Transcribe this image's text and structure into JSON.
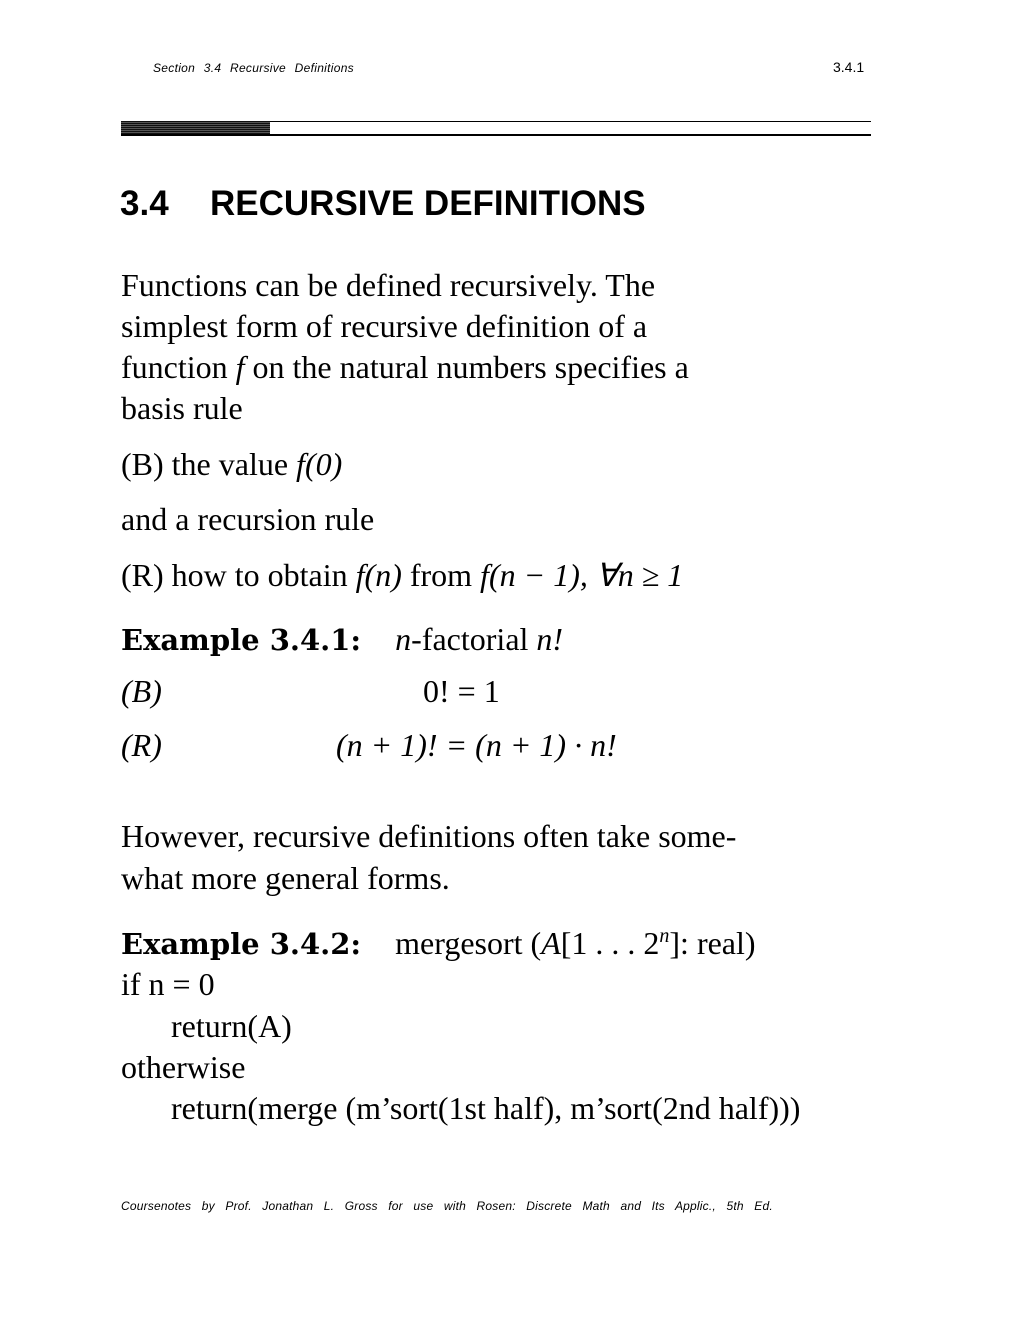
{
  "header": {
    "running_title": "Section 3.4 Recursive Definitions",
    "page_number": "3.4.1"
  },
  "section": {
    "number": "3.4",
    "title": "RECURSIVE DEFINITIONS"
  },
  "intro": {
    "lines": [
      "Functions can be defined recursively.  The",
      "simplest form of recursive definition of a",
      "function",
      "on the natural numbers specifies a",
      "basis rule"
    ],
    "var_f": "f"
  },
  "basis": {
    "label": "(B) the value",
    "expr": "f(0)"
  },
  "recursion_intro": "and a recursion rule",
  "recursion": {
    "label": "(R) how to obtain",
    "expr1": "f(n)",
    "from": "from",
    "expr2": "f(n − 1), ∀n ≥ 1"
  },
  "example1": {
    "label": "Example 3.4.1:",
    "var": "n",
    "desc": "-factorial",
    "nfact": "n!",
    "rows": [
      {
        "tag": "(B)",
        "formula": "0! = 1"
      },
      {
        "tag": "(R)",
        "formula": "(n + 1)! = (n + 1) · n!"
      }
    ]
  },
  "general": {
    "lines": [
      "However, recursive definitions often take some-",
      "what more general forms."
    ]
  },
  "example2": {
    "label": "Example 3.4.2:",
    "signature_pre": "mergesort (",
    "signature_A": "A",
    "signature_range": "[1 . . . 2",
    "signature_exp": "n",
    "signature_post": "]:  real)",
    "code": [
      "if n = 0",
      "return(A)",
      "otherwise",
      "return(merge (m’sort(1st half), m’sort(2nd half)))"
    ]
  },
  "footer": {
    "text": "Coursenotes by Prof.  Jonathan L. Gross for use with Rosen:  Discrete Math and Its Applic., 5th Ed."
  }
}
